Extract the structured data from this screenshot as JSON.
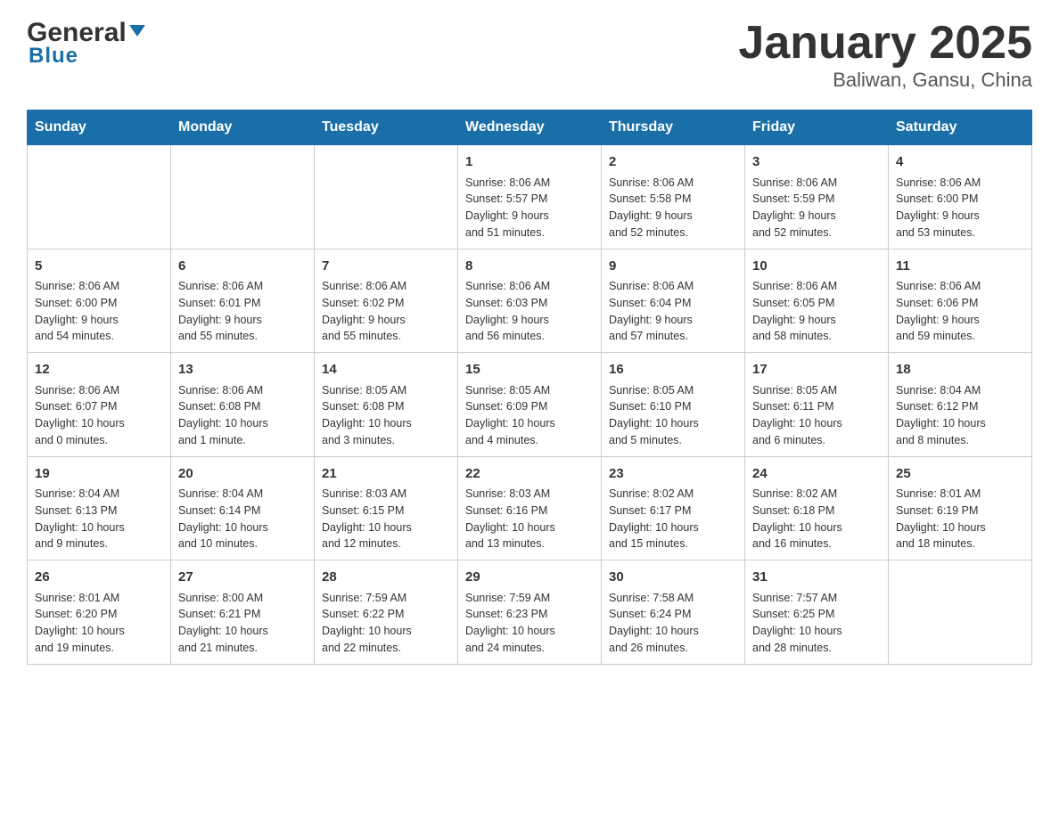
{
  "header": {
    "logo_name": "General",
    "logo_sub": "Blue",
    "title": "January 2025",
    "subtitle": "Baliwan, Gansu, China"
  },
  "calendar": {
    "days_of_week": [
      "Sunday",
      "Monday",
      "Tuesday",
      "Wednesday",
      "Thursday",
      "Friday",
      "Saturday"
    ],
    "weeks": [
      [
        {
          "day": "",
          "info": ""
        },
        {
          "day": "",
          "info": ""
        },
        {
          "day": "",
          "info": ""
        },
        {
          "day": "1",
          "info": "Sunrise: 8:06 AM\nSunset: 5:57 PM\nDaylight: 9 hours\nand 51 minutes."
        },
        {
          "day": "2",
          "info": "Sunrise: 8:06 AM\nSunset: 5:58 PM\nDaylight: 9 hours\nand 52 minutes."
        },
        {
          "day": "3",
          "info": "Sunrise: 8:06 AM\nSunset: 5:59 PM\nDaylight: 9 hours\nand 52 minutes."
        },
        {
          "day": "4",
          "info": "Sunrise: 8:06 AM\nSunset: 6:00 PM\nDaylight: 9 hours\nand 53 minutes."
        }
      ],
      [
        {
          "day": "5",
          "info": "Sunrise: 8:06 AM\nSunset: 6:00 PM\nDaylight: 9 hours\nand 54 minutes."
        },
        {
          "day": "6",
          "info": "Sunrise: 8:06 AM\nSunset: 6:01 PM\nDaylight: 9 hours\nand 55 minutes."
        },
        {
          "day": "7",
          "info": "Sunrise: 8:06 AM\nSunset: 6:02 PM\nDaylight: 9 hours\nand 55 minutes."
        },
        {
          "day": "8",
          "info": "Sunrise: 8:06 AM\nSunset: 6:03 PM\nDaylight: 9 hours\nand 56 minutes."
        },
        {
          "day": "9",
          "info": "Sunrise: 8:06 AM\nSunset: 6:04 PM\nDaylight: 9 hours\nand 57 minutes."
        },
        {
          "day": "10",
          "info": "Sunrise: 8:06 AM\nSunset: 6:05 PM\nDaylight: 9 hours\nand 58 minutes."
        },
        {
          "day": "11",
          "info": "Sunrise: 8:06 AM\nSunset: 6:06 PM\nDaylight: 9 hours\nand 59 minutes."
        }
      ],
      [
        {
          "day": "12",
          "info": "Sunrise: 8:06 AM\nSunset: 6:07 PM\nDaylight: 10 hours\nand 0 minutes."
        },
        {
          "day": "13",
          "info": "Sunrise: 8:06 AM\nSunset: 6:08 PM\nDaylight: 10 hours\nand 1 minute."
        },
        {
          "day": "14",
          "info": "Sunrise: 8:05 AM\nSunset: 6:08 PM\nDaylight: 10 hours\nand 3 minutes."
        },
        {
          "day": "15",
          "info": "Sunrise: 8:05 AM\nSunset: 6:09 PM\nDaylight: 10 hours\nand 4 minutes."
        },
        {
          "day": "16",
          "info": "Sunrise: 8:05 AM\nSunset: 6:10 PM\nDaylight: 10 hours\nand 5 minutes."
        },
        {
          "day": "17",
          "info": "Sunrise: 8:05 AM\nSunset: 6:11 PM\nDaylight: 10 hours\nand 6 minutes."
        },
        {
          "day": "18",
          "info": "Sunrise: 8:04 AM\nSunset: 6:12 PM\nDaylight: 10 hours\nand 8 minutes."
        }
      ],
      [
        {
          "day": "19",
          "info": "Sunrise: 8:04 AM\nSunset: 6:13 PM\nDaylight: 10 hours\nand 9 minutes."
        },
        {
          "day": "20",
          "info": "Sunrise: 8:04 AM\nSunset: 6:14 PM\nDaylight: 10 hours\nand 10 minutes."
        },
        {
          "day": "21",
          "info": "Sunrise: 8:03 AM\nSunset: 6:15 PM\nDaylight: 10 hours\nand 12 minutes."
        },
        {
          "day": "22",
          "info": "Sunrise: 8:03 AM\nSunset: 6:16 PM\nDaylight: 10 hours\nand 13 minutes."
        },
        {
          "day": "23",
          "info": "Sunrise: 8:02 AM\nSunset: 6:17 PM\nDaylight: 10 hours\nand 15 minutes."
        },
        {
          "day": "24",
          "info": "Sunrise: 8:02 AM\nSunset: 6:18 PM\nDaylight: 10 hours\nand 16 minutes."
        },
        {
          "day": "25",
          "info": "Sunrise: 8:01 AM\nSunset: 6:19 PM\nDaylight: 10 hours\nand 18 minutes."
        }
      ],
      [
        {
          "day": "26",
          "info": "Sunrise: 8:01 AM\nSunset: 6:20 PM\nDaylight: 10 hours\nand 19 minutes."
        },
        {
          "day": "27",
          "info": "Sunrise: 8:00 AM\nSunset: 6:21 PM\nDaylight: 10 hours\nand 21 minutes."
        },
        {
          "day": "28",
          "info": "Sunrise: 7:59 AM\nSunset: 6:22 PM\nDaylight: 10 hours\nand 22 minutes."
        },
        {
          "day": "29",
          "info": "Sunrise: 7:59 AM\nSunset: 6:23 PM\nDaylight: 10 hours\nand 24 minutes."
        },
        {
          "day": "30",
          "info": "Sunrise: 7:58 AM\nSunset: 6:24 PM\nDaylight: 10 hours\nand 26 minutes."
        },
        {
          "day": "31",
          "info": "Sunrise: 7:57 AM\nSunset: 6:25 PM\nDaylight: 10 hours\nand 28 minutes."
        },
        {
          "day": "",
          "info": ""
        }
      ]
    ]
  }
}
